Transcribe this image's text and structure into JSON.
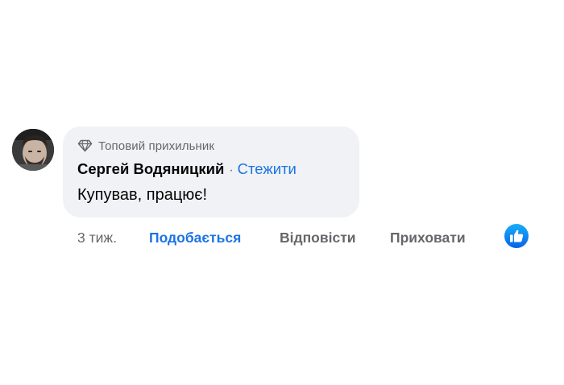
{
  "comment": {
    "badge": {
      "icon": "diamond-icon",
      "label": "Топовий прихильник"
    },
    "author": "Сергей Водяницкий",
    "separator": "·",
    "follow_label": "Стежити",
    "text": "Купував, працює!",
    "avatar_icon": "user-avatar"
  },
  "actions": {
    "time": "3 тиж.",
    "like_label": "Подобається",
    "reply_label": "Відповісти",
    "hide_label": "Приховати",
    "reaction_icon": "thumbs-up-icon"
  },
  "colors": {
    "bubble": "#f0f2f5",
    "link_blue": "#1b74e4",
    "secondary_text": "#65676b",
    "primary_text": "#050505"
  }
}
